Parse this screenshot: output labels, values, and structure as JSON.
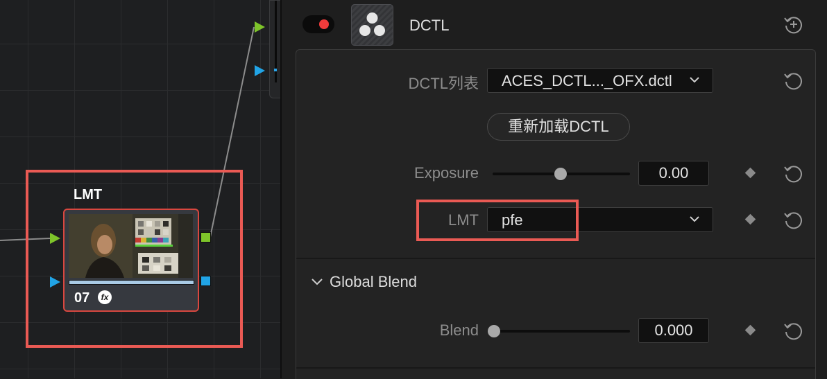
{
  "node_editor": {
    "node": {
      "title": "LMT",
      "number": "07",
      "fx_badge": "fx",
      "progress": 1.0
    }
  },
  "inspector": {
    "plugin_title": "DCTL",
    "enabled": true,
    "dctl_list": {
      "label": "DCTL列表",
      "value": "ACES_DCTL..._OFX.dctl"
    },
    "reload_button": "重新加载DCTL",
    "exposure": {
      "label": "Exposure",
      "value": "0.00",
      "slider_fraction": 0.5
    },
    "lmt": {
      "label": "LMT",
      "value": "pfe"
    },
    "global_blend": {
      "header": "Global Blend",
      "blend": {
        "label": "Blend",
        "value": "0.000",
        "slider_fraction": 0.0
      }
    }
  },
  "colors": {
    "highlight": "#ea5a54",
    "green_connector": "#7ec42a",
    "blue_connector": "#21a4e6",
    "toggle_on": "#ef3b3b"
  }
}
